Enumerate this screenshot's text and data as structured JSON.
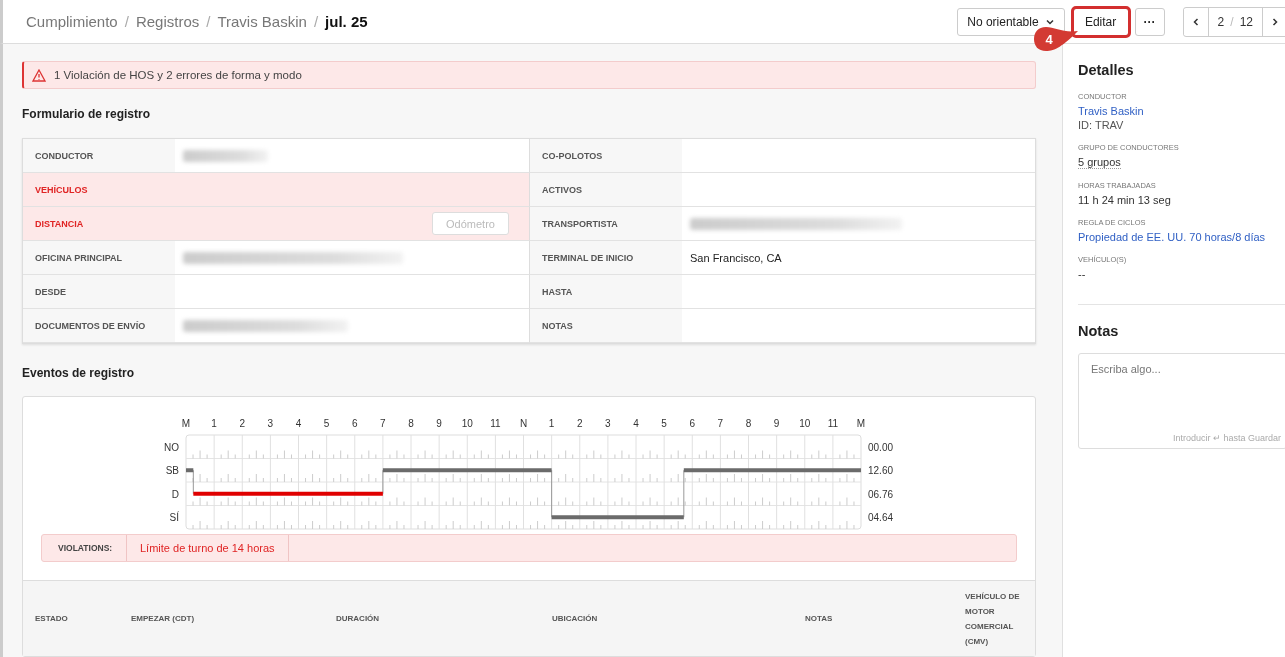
{
  "breadcrumb": [
    {
      "label": "Cumplimiento",
      "current": false
    },
    {
      "separator": "/",
      "label": "Registros",
      "current": false
    },
    {
      "separator": "/",
      "label": "Travis Baskin",
      "current": false
    },
    {
      "separator": "/",
      "label": "jul. 25",
      "current": true
    }
  ],
  "toolbar": {
    "dropdown": "No orientable",
    "edit_button": {
      "label": "Editar",
      "highlighted": true
    },
    "more_button": "···",
    "pager": {
      "current": "2",
      "separator": "/",
      "total": "12"
    }
  },
  "callout": "4",
  "alert": "1 Violación de HOS y 2 errores de forma y modo",
  "form": {
    "title": "Formulario de registro",
    "rows": [
      {
        "left": {
          "label": "CONDUCTOR",
          "error": false,
          "blurred": true
        },
        "right": {
          "label": "CO-POLOTOS",
          "error": false,
          "blurred": false
        }
      },
      {
        "left": {
          "label": "VEHÍCULOS",
          "error": true,
          "blurred": false
        },
        "right": {
          "label": "ACTIVOS",
          "error": false,
          "blurred": false
        }
      },
      {
        "left": {
          "label": "DISTANCIA",
          "error": true,
          "blurred": false,
          "button": {
            "label": "Odómetro",
            "disabled": true
          }
        },
        "right": {
          "label": "TRANSPORTISTA",
          "error": false,
          "blurred": true
        }
      },
      {
        "left": {
          "label": "OFICINA PRINCIPAL",
          "error": false,
          "blurred": true
        },
        "right": {
          "label": "TERMINAL DE INICIO",
          "error": false,
          "blurred": false,
          "value": "San Francisco, CA"
        }
      },
      {
        "left": {
          "label": "DESDE",
          "error": false,
          "blurred": false
        },
        "right": {
          "label": "HASTA",
          "error": false,
          "blurred": false
        }
      },
      {
        "left": {
          "label": "DOCUMENTOS DE ENVÍO",
          "error": false,
          "blurred": true
        },
        "right": {
          "label": "NOTAS",
          "error": false,
          "blurred": false
        }
      }
    ]
  },
  "events": {
    "title": "Eventos de registro",
    "hours": [
      "M",
      "1",
      "2",
      "3",
      "4",
      "5",
      "6",
      "7",
      "8",
      "9",
      "10",
      "11",
      "N",
      "1",
      "2",
      "3",
      "4",
      "5",
      "6",
      "7",
      "8",
      "9",
      "10",
      "11",
      "M"
    ],
    "statuses": [
      {
        "label": "NO",
        "total": "00.00"
      },
      {
        "label": "SB",
        "total": "12.60"
      },
      {
        "label": "D",
        "total": "06.76"
      },
      {
        "label": "SÍ",
        "total": "04.64"
      }
    ],
    "violations": {
      "label": "VIOLATIONS:",
      "items": [
        "Límite de turno de 14 horas"
      ]
    },
    "columns": [
      "ESTADO",
      "EMPEZAR (CDT)",
      "DURACIÓN",
      "UBICACIÓN",
      "NOTAS",
      "VEHÍCULO DE MOTOR COMERCIAL (CMV)"
    ]
  },
  "details": {
    "title": "Detalles",
    "items": [
      {
        "label": "CONDUCTOR",
        "value": "Travis Baskin",
        "kind": "link",
        "sub": "ID: TRAV"
      },
      {
        "label": "GRUPO DE CONDUCTORES",
        "value": "5 grupos",
        "kind": "dotted"
      },
      {
        "label": "HORAS TRABAJADAS",
        "value": "11 h 24 min 13 seg",
        "kind": "text"
      },
      {
        "label": "REGLA DE CICLOS",
        "value": "Propiedad de EE. UU. 70 horas/8 días",
        "kind": "link"
      },
      {
        "label": "VEHÍCULO(S)",
        "value": "--",
        "kind": "text"
      }
    ]
  },
  "notes": {
    "title": "Notas",
    "placeholder": "Escriba algo...",
    "hint": "Introducir ↵ hasta Guardar"
  }
}
